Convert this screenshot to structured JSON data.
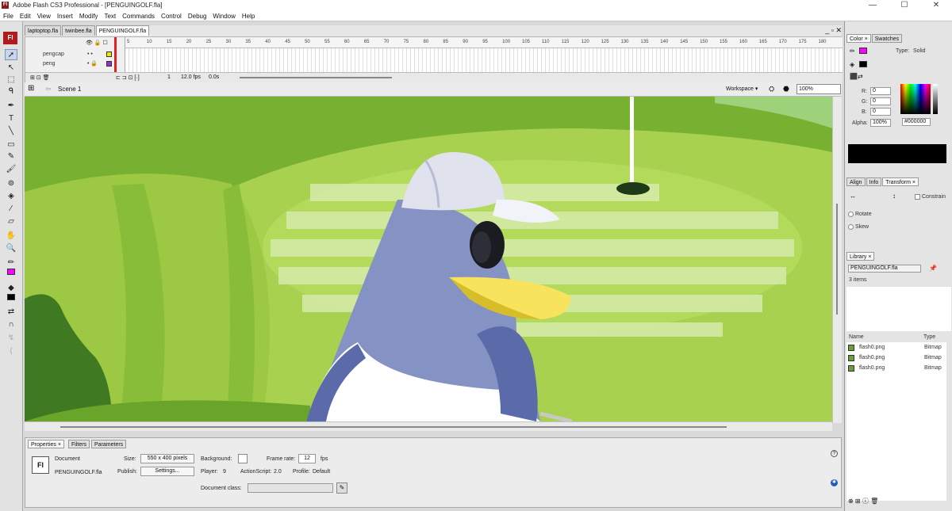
{
  "app": {
    "title": "Adobe Flash CS3 Professional - [PENGUINGOLF.fla]",
    "logo": "Fl"
  },
  "window_controls": {
    "minimize": "—",
    "maximize": "☐",
    "close": "✕"
  },
  "menu": [
    "File",
    "Edit",
    "View",
    "Insert",
    "Modify",
    "Text",
    "Commands",
    "Control",
    "Debug",
    "Window",
    "Help"
  ],
  "tools_logo": "Fl",
  "doc_tabs": [
    "laptoptop.fla",
    "twinbee.fla",
    "PENGUINGOLF.fla"
  ],
  "doc_controls": "_ ▫ ✕",
  "timeline": {
    "layers": [
      {
        "name": "pengcap",
        "color": "#e8e800"
      },
      {
        "name": "peng",
        "color": "#9b2fc4"
      }
    ],
    "ruler_ticks": [
      "5",
      "10",
      "15",
      "20",
      "25",
      "30",
      "35",
      "40",
      "45",
      "50",
      "55",
      "60",
      "65",
      "70",
      "75",
      "80",
      "85",
      "90",
      "95",
      "100",
      "105",
      "110",
      "115",
      "120",
      "125",
      "130",
      "135",
      "140",
      "145",
      "150",
      "155",
      "160",
      "165",
      "170",
      "175",
      "180"
    ],
    "current_frame": "1",
    "frame_rate": "12.0 fps",
    "elapsed": "0.0s"
  },
  "edit_bar": {
    "scene": "Scene 1",
    "workspace": "Workspace ▾",
    "zoom": "100%"
  },
  "properties": {
    "tabs": [
      "Properties ×",
      "Filters",
      "Parameters"
    ],
    "doc_icon": "Fl",
    "doc_type": "Document",
    "doc_name": "PENGUINGOLF.fla",
    "size_label": "Size:",
    "size_value": "550 x 400 pixels",
    "background_label": "Background:",
    "frame_rate_label": "Frame rate:",
    "frame_rate_value": "12",
    "fps_unit": "fps",
    "publish_label": "Publish:",
    "settings_button": "Settings...",
    "player_label": "Player:",
    "player_value": "9",
    "as_label": "ActionScript:",
    "as_value": "2.0",
    "profile_label": "Profile:",
    "profile_value": "Default",
    "docclass_label": "Document class:"
  },
  "color_panel": {
    "tabs": [
      "Color ×",
      "Swatches"
    ],
    "type_label": "Type:",
    "type_value": "Solid",
    "r_label": "R:",
    "r": "0",
    "g_label": "G:",
    "g": "0",
    "b_label": "B:",
    "b": "0",
    "alpha_label": "Alpha:",
    "alpha": "100%",
    "hex": "#000000",
    "preview_color": "#000000"
  },
  "transform_panel": {
    "tabs": [
      "Align",
      "Info",
      "Transform ×"
    ],
    "constrain": "Constrain",
    "rotate": "Rotate",
    "skew": "Skew"
  },
  "library": {
    "tab": "Library ×",
    "file": "PENGUINGOLF.fla",
    "count": "3 items",
    "col_name": "Name",
    "col_type": "Type",
    "items": [
      {
        "name": "flash0.png",
        "type": "Bitmap"
      },
      {
        "name": "flash0.png",
        "type": "Bitmap"
      },
      {
        "name": "flash0.png",
        "type": "Bitmap"
      }
    ]
  }
}
